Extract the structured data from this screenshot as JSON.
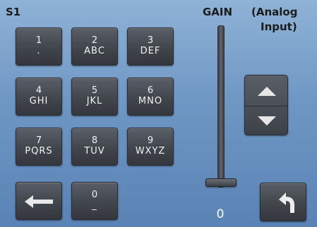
{
  "header": {
    "screen_label": "S1",
    "gain_label": "GAIN",
    "input_label_line1": "(Analog",
    "input_label_line2": "Input)"
  },
  "keypad": [
    {
      "num": "1",
      "letters": "."
    },
    {
      "num": "2",
      "letters": "ABC"
    },
    {
      "num": "3",
      "letters": "DEF"
    },
    {
      "num": "4",
      "letters": "GHI"
    },
    {
      "num": "5",
      "letters": "JKL"
    },
    {
      "num": "6",
      "letters": "MNO"
    },
    {
      "num": "7",
      "letters": "PQRS"
    },
    {
      "num": "8",
      "letters": "TUV"
    },
    {
      "num": "9",
      "letters": "WXYZ"
    },
    {
      "num": "0",
      "letters": "_"
    }
  ],
  "icons": {
    "backspace": "left-arrow-icon",
    "up": "triangle-up-icon",
    "down": "triangle-down-icon",
    "back": "return-arrow-icon"
  },
  "gain": {
    "value": "0",
    "level": 0
  },
  "colors": {
    "background_top": "#8fb2d6",
    "background_bottom": "#5a83b5",
    "key": "#41454c",
    "key_text": "#f2f2f2",
    "label_text": "#1c1c1c"
  }
}
